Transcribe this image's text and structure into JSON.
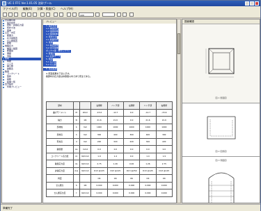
{
  "window": {
    "title": "UC-1 FFC Ver.1.01.05 沈砂プール"
  },
  "menu": [
    "ファイル(F)",
    "編集(E)",
    "計算・照査(C)",
    "ヘルプ(H)"
  ],
  "toolbar": {
    "zoom_value": "100"
  },
  "tree": {
    "items": [
      "計算書印刷",
      "設計条件",
      "材料・許容応力度",
      "形状寸法",
      "荷重",
      "土圧・水圧",
      "断面力",
      "応力度照査",
      "せん断照査",
      "配筋",
      "地盤反力",
      "構造一般図",
      "断面図",
      "側壁",
      "頂版",
      "底版",
      "隔壁",
      "ハンチ",
      "開口部",
      "鉄筋表",
      "数量",
      "コンクリート",
      "型枠",
      "鉄筋",
      "結果一覧",
      "出力設定",
      "印刷プレビュー"
    ],
    "selected_index": 15
  },
  "document": {
    "tab_label": "プレビュー",
    "lines": [
      "1. 設計条件",
      "1-1 構造形式",
      "1-2 適用基準",
      "1-3 使用材料",
      "2. 形状寸法",
      "2-1 断面形状",
      "3. 荷重",
      "3-1 鉛直荷重",
      "3-2 水平荷重",
      "   ボックス型（単ボックス）",
      "4. 断面力",
      "4-1 計算ケース",
      "5. 照査",
      "5-1 応力度",
      "5-2 せん断"
    ],
    "note_lines": [
      "6. 照査結果",
      "",
      "※ 照査結果を下表に示す。",
      "各部材の応力度は許容値以内であり安全である。"
    ],
    "table": {
      "headers": [
        "部材",
        "",
        "",
        "左側壁",
        "ハンチ部",
        "左隔壁",
        "ハンチ部",
        "右側壁"
      ],
      "rows": [
        [
          "曲げモーメント",
          "M",
          "kN.m",
          "-15.6",
          "-12.7",
          "0.0",
          "-12.7",
          "-15.6"
        ],
        [
          "軸力",
          "N",
          "kN",
          "21.6",
          "21.6",
          "0.0",
          "21.6",
          "21.6"
        ],
        [
          "部材幅",
          "b",
          "mm",
          "1000",
          "1000",
          "1000",
          "1000",
          "1000"
        ],
        [
          "部材高",
          "h",
          "mm",
          "300",
          "400",
          "300",
          "400",
          "300"
        ],
        [
          "有効高",
          "d",
          "mm",
          "220",
          "320",
          "220",
          "320",
          "220"
        ],
        [
          "鉄筋量",
          "As",
          "mm2",
          "0.0",
          "0.0",
          "0.0",
          "0.0",
          "0.0"
        ],
        [
          "コンクリート応力度",
          "σc",
          "N/mm2",
          "1.9",
          "1.4",
          "0.0",
          "1.4",
          "1.9"
        ],
        [
          "鉄筋応力度",
          "σs",
          "N/mm2",
          "2.75",
          "1.26",
          "0.00",
          "1.26",
          "2.75"
        ],
        [
          "許容応力度",
          "σca",
          "N/mm2",
          "D13 @125",
          "D13 @125",
          "D13 @250",
          "D13 @125",
          "D13 @125"
        ],
        [
          "判定",
          "",
          "",
          "OK",
          "OK",
          "OK",
          "OK",
          "OK"
        ],
        [
          "せん断力",
          "S",
          "kN",
          "0.000",
          "0.000",
          "0.000",
          "0.000",
          "0.000"
        ],
        [
          "せん断応力度",
          "τ",
          "N/mm2",
          "0.000",
          "0.000",
          "0.000",
          "0.000",
          "0.000"
        ]
      ]
    }
  },
  "preview": {
    "header": "図面確認",
    "panels": [
      {
        "label": "図-1 断面図"
      },
      {
        "label": "図-2 配筋図"
      },
      {
        "label": "図-3 側面図"
      }
    ]
  },
  "status": {
    "text": "準備完了"
  },
  "colors": {
    "accent": "#2852b8",
    "titlebar": "#2e5fb8",
    "chrome": "#ece9d8"
  }
}
